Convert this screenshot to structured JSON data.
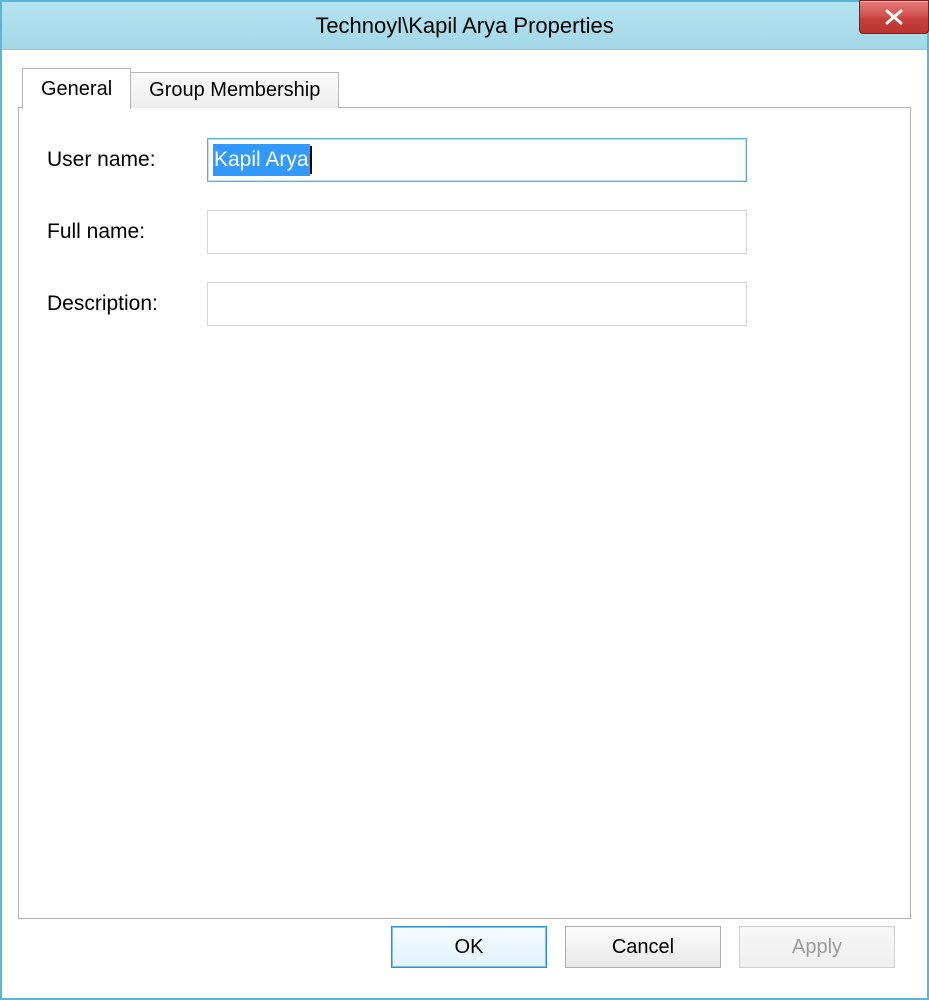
{
  "window": {
    "title": "Technoyl\\Kapil Arya Properties"
  },
  "tabs": [
    {
      "label": "General",
      "active": true
    },
    {
      "label": "Group Membership",
      "active": false
    }
  ],
  "form": {
    "username_label": "User name:",
    "username_value": "Kapil Arya",
    "fullname_label": "Full name:",
    "fullname_value": "",
    "description_label": "Description:",
    "description_value": ""
  },
  "buttons": {
    "ok": "OK",
    "cancel": "Cancel",
    "apply": "Apply"
  }
}
